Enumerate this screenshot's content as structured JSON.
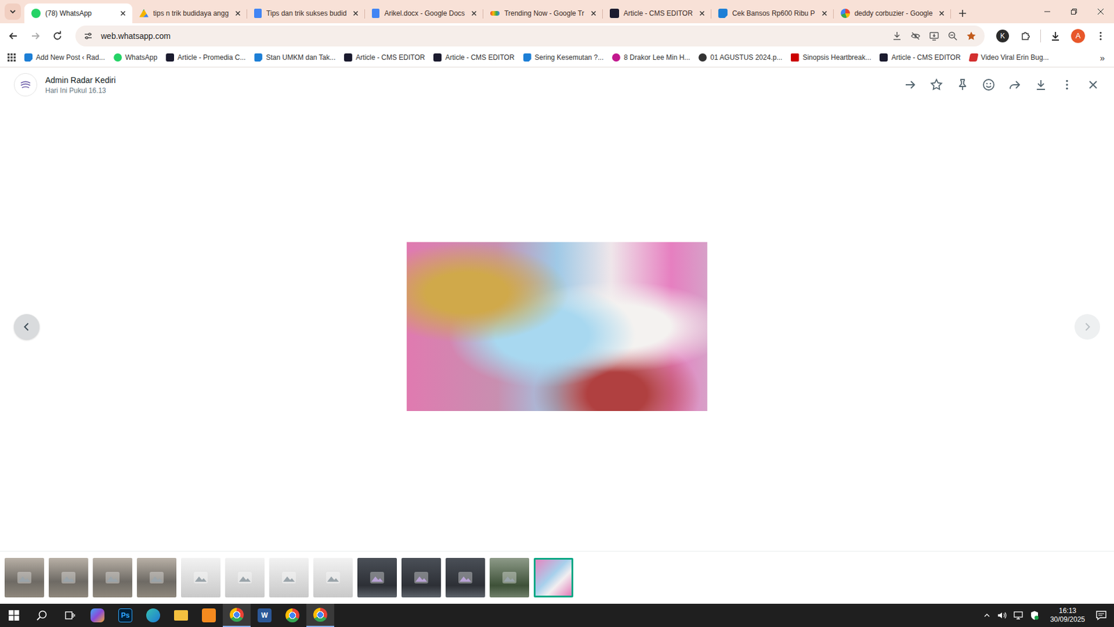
{
  "tabs": [
    {
      "label": "(78) WhatsApp",
      "kind": "whatsapp",
      "selected": true
    },
    {
      "label": "tips n trik budidaya angg",
      "kind": "drive",
      "selected": false
    },
    {
      "label": "Tips dan trik sukses budid",
      "kind": "docs",
      "selected": false
    },
    {
      "label": "Arikel.docx - Google Docs",
      "kind": "docs",
      "selected": false
    },
    {
      "label": "Trending Now - Google Tr",
      "kind": "trends",
      "selected": false
    },
    {
      "label": "Article - CMS EDITOR",
      "kind": "cms",
      "selected": false
    },
    {
      "label": "Cek Bansos Rp600 Ribu P",
      "kind": "wp",
      "selected": false
    },
    {
      "label": "deddy corbuzier - Google",
      "kind": "google",
      "selected": false
    }
  ],
  "address_bar": {
    "url": "web.whatsapp.com"
  },
  "profiles": {
    "extension_avatar": "K",
    "user_avatar": "A"
  },
  "bookmarks": {
    "items": [
      {
        "label": "Add New Post ‹ Rad...",
        "kind": "wp"
      },
      {
        "label": "WhatsApp",
        "kind": "whatsapp"
      },
      {
        "label": "Article - Promedia C...",
        "kind": "cms"
      },
      {
        "label": "Stan UMKM dan Tak...",
        "kind": "wp"
      },
      {
        "label": "Article - CMS EDITOR",
        "kind": "cms"
      },
      {
        "label": "Article - CMS EDITOR",
        "kind": "cms"
      },
      {
        "label": "Sering Kesemutan ?...",
        "kind": "wp"
      },
      {
        "label": "8 Drakor Lee Min H...",
        "kind": "lu"
      },
      {
        "label": "01 AGUSTUS 2024.p...",
        "kind": "globe"
      },
      {
        "label": "Sinopsis Heartbreak...",
        "kind": "cnn"
      },
      {
        "label": "Article - CMS EDITOR",
        "kind": "cms"
      },
      {
        "label": "Video Viral Erin Bug...",
        "kind": "d"
      }
    ],
    "overflow": "»"
  },
  "viewer": {
    "sender": "Admin Radar Kediri",
    "time": "Hari Ini Pukul 16.13",
    "prev": {
      "disabled": false
    },
    "next": {
      "disabled": true
    },
    "thumbnails": [
      {
        "kind": "photo",
        "selected": false
      },
      {
        "kind": "photo",
        "selected": false
      },
      {
        "kind": "photo",
        "selected": false
      },
      {
        "kind": "photo",
        "selected": false
      },
      {
        "kind": "photo",
        "selected": false
      },
      {
        "kind": "blank",
        "selected": false
      },
      {
        "kind": "blank",
        "selected": false
      },
      {
        "kind": "blank",
        "selected": false
      },
      {
        "kind": "blank",
        "selected": false
      },
      {
        "kind": "dark",
        "selected": false
      },
      {
        "kind": "dark",
        "selected": false
      },
      {
        "kind": "dark",
        "selected": false
      },
      {
        "kind": "green",
        "selected": false
      },
      {
        "kind": "current",
        "selected": true
      }
    ]
  },
  "taskbar": {
    "apps": [
      {
        "kind": "start",
        "text": "",
        "active": false
      },
      {
        "kind": "search",
        "text": "",
        "active": false
      },
      {
        "kind": "taskview",
        "text": "",
        "active": false
      },
      {
        "kind": "copilot",
        "text": "",
        "active": false
      },
      {
        "kind": "photoshop",
        "text": "Ps",
        "active": false
      },
      {
        "kind": "edge",
        "text": "",
        "active": false
      },
      {
        "kind": "explorer",
        "text": "",
        "active": false
      },
      {
        "kind": "orange",
        "text": "",
        "active": false
      },
      {
        "kind": "chrome",
        "text": "",
        "active": true
      },
      {
        "kind": "word",
        "text": "W",
        "active": false
      },
      {
        "kind": "chrome",
        "text": "",
        "active": false
      },
      {
        "kind": "chrome",
        "text": "",
        "active": true
      }
    ],
    "time": "16:13",
    "date": "30/09/2025"
  }
}
